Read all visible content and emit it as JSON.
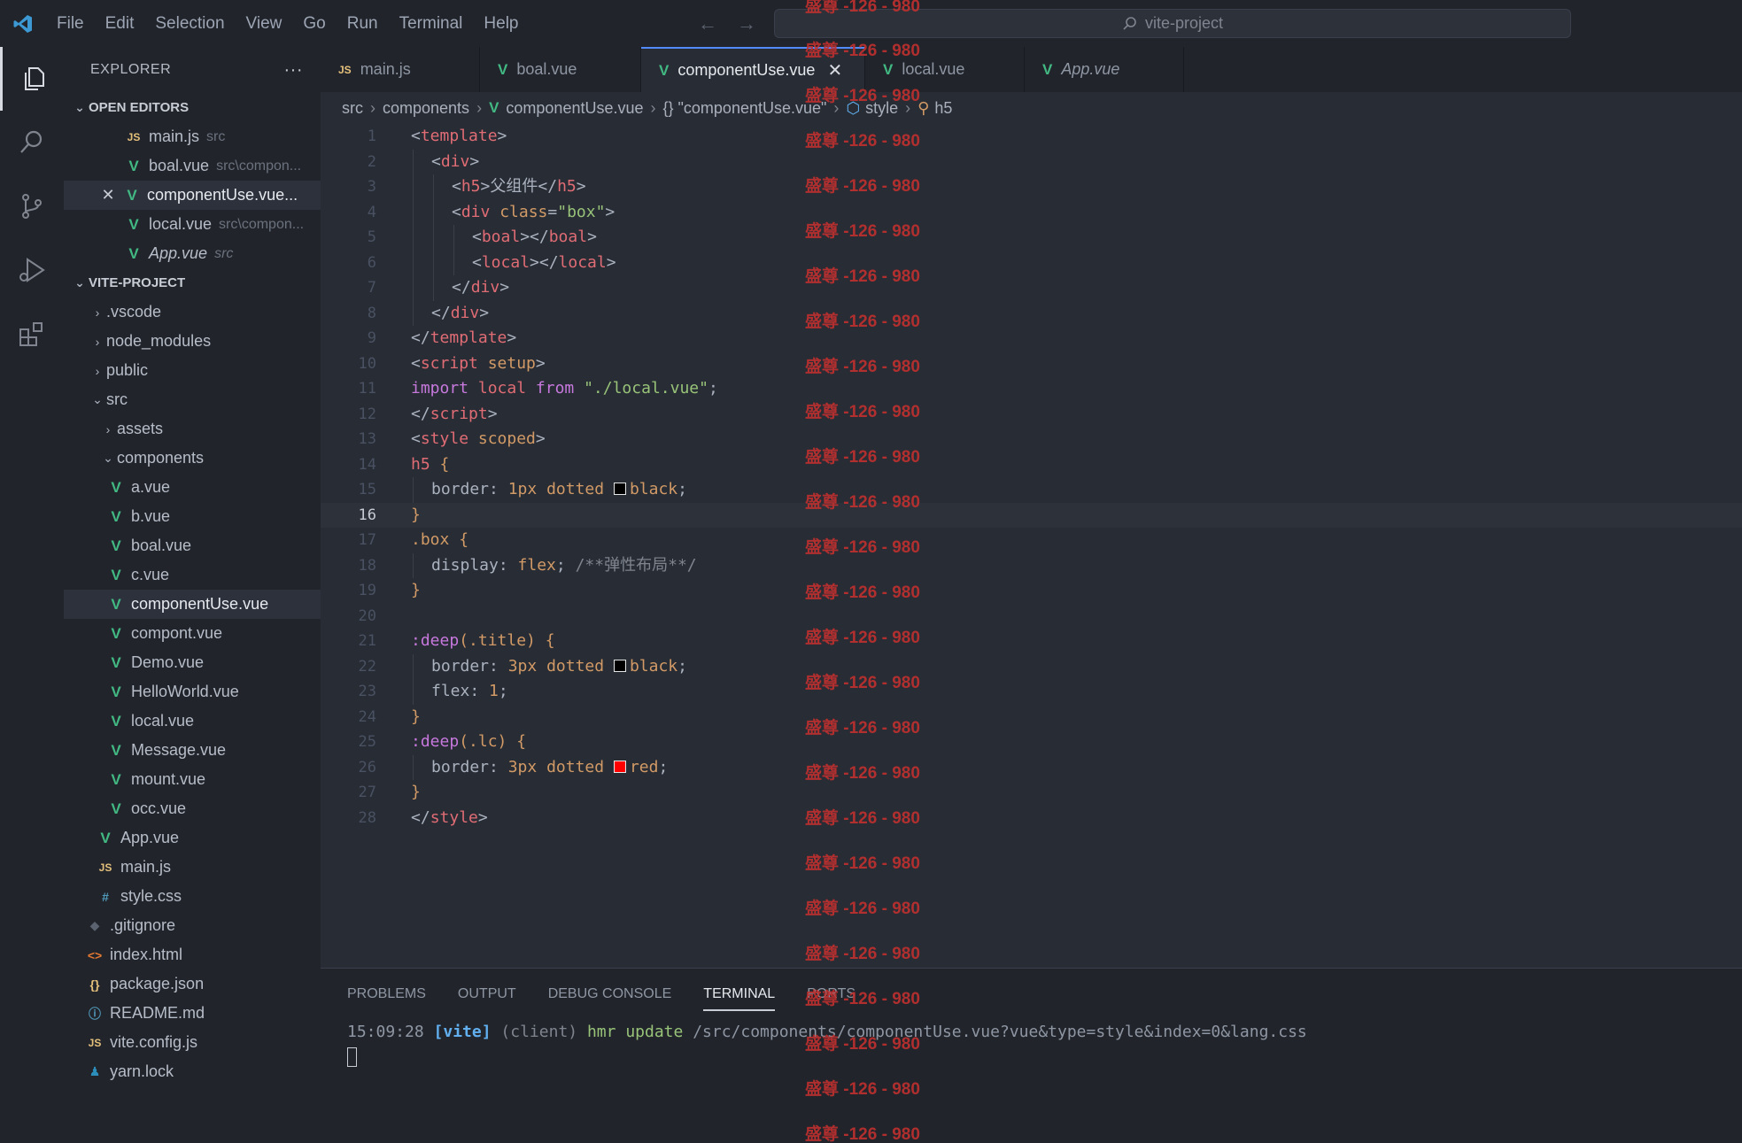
{
  "menu": [
    "File",
    "Edit",
    "Selection",
    "View",
    "Go",
    "Run",
    "Terminal",
    "Help"
  ],
  "command_center": "vite-project",
  "explorer": {
    "title": "EXPLORER",
    "more": "···",
    "open_editors_title": "OPEN EDITORS",
    "open_editors": [
      {
        "icon": "JS",
        "name": "main.js",
        "path": "src"
      },
      {
        "icon": "V",
        "name": "boal.vue",
        "path": "src\\compon..."
      },
      {
        "icon": "V",
        "name": "componentUse.vue...",
        "path": ""
      },
      {
        "icon": "V",
        "name": "local.vue",
        "path": "src\\compon..."
      },
      {
        "icon": "V",
        "name": "App.vue",
        "path": "src"
      }
    ],
    "project_title": "VITE-PROJECT",
    "tree": [
      {
        "name": ".vscode",
        "type": "folder"
      },
      {
        "name": "node_modules",
        "type": "folder"
      },
      {
        "name": "public",
        "type": "folder"
      },
      {
        "name": "src",
        "type": "folder-open"
      },
      {
        "name": "assets",
        "type": "folder"
      },
      {
        "name": "components",
        "type": "folder-open"
      },
      {
        "name": "a.vue",
        "type": "vue"
      },
      {
        "name": "b.vue",
        "type": "vue"
      },
      {
        "name": "boal.vue",
        "type": "vue"
      },
      {
        "name": "c.vue",
        "type": "vue"
      },
      {
        "name": "componentUse.vue",
        "type": "vue"
      },
      {
        "name": "compont.vue",
        "type": "vue"
      },
      {
        "name": "Demo.vue",
        "type": "vue"
      },
      {
        "name": "HelloWorld.vue",
        "type": "vue"
      },
      {
        "name": "local.vue",
        "type": "vue"
      },
      {
        "name": "Message.vue",
        "type": "vue"
      },
      {
        "name": "mount.vue",
        "type": "vue"
      },
      {
        "name": "occ.vue",
        "type": "vue"
      },
      {
        "name": "App.vue",
        "type": "vue"
      },
      {
        "name": "main.js",
        "type": "js"
      },
      {
        "name": "style.css",
        "type": "css"
      },
      {
        "name": ".gitignore",
        "type": "git"
      },
      {
        "name": "index.html",
        "type": "html"
      },
      {
        "name": "package.json",
        "type": "json"
      },
      {
        "name": "README.md",
        "type": "info"
      },
      {
        "name": "vite.config.js",
        "type": "js"
      },
      {
        "name": "yarn.lock",
        "type": "yarn"
      }
    ]
  },
  "tabs": [
    {
      "icon": "JS",
      "label": "main.js"
    },
    {
      "icon": "V",
      "label": "boal.vue"
    },
    {
      "icon": "V",
      "label": "componentUse.vue",
      "close": "✕"
    },
    {
      "icon": "V",
      "label": "local.vue"
    },
    {
      "icon": "V",
      "label": "App.vue"
    }
  ],
  "breadcrumb": {
    "src": "src",
    "components": "components",
    "file": "componentUse.vue",
    "block": "{} \"componentUse.vue\"",
    "style": "style",
    "h5": "h5"
  },
  "code": {
    "line_numbers": [
      "1",
      "2",
      "3",
      "4",
      "5",
      "6",
      "7",
      "8",
      "9",
      "10",
      "11",
      "12",
      "13",
      "14",
      "15",
      "16",
      "17",
      "18",
      "19",
      "20",
      "21",
      "22",
      "23",
      "24",
      "25",
      "26",
      "27",
      "28"
    ],
    "l1": [
      "<",
      "template",
      ">"
    ],
    "l2": [
      "<",
      "div",
      ">"
    ],
    "l3": [
      "<",
      "h5",
      ">",
      "父组件",
      "</",
      "h5",
      ">"
    ],
    "l4": [
      "<",
      "div",
      " class",
      "=",
      "\"box\"",
      ">"
    ],
    "l5": [
      "<",
      "boal",
      "></",
      "boal",
      ">"
    ],
    "l6": [
      "<",
      "local",
      "></",
      "local",
      ">"
    ],
    "l7": [
      "</",
      "div",
      ">"
    ],
    "l8": [
      "</",
      "div",
      ">"
    ],
    "l9": [
      "</",
      "template",
      ">"
    ],
    "l10": [
      "<",
      "script",
      " setup",
      ">"
    ],
    "l11": [
      "import",
      " local ",
      "from",
      " \"./local.vue\"",
      ";"
    ],
    "l12": [
      "</",
      "script",
      ">"
    ],
    "l13": [
      "<",
      "style",
      " scoped",
      ">"
    ],
    "l14": [
      "h5",
      " {"
    ],
    "l15": [
      "border",
      ": ",
      "1px",
      " dotted ",
      "black",
      ";"
    ],
    "l16": [
      "}"
    ],
    "l17": [
      ".box",
      " {"
    ],
    "l18": [
      "display",
      ": ",
      "flex",
      "; ",
      "/**弹性布局**/"
    ],
    "l19": [
      "}"
    ],
    "l20": [
      ""
    ],
    "l21": [
      ":deep",
      "(.title)",
      " {"
    ],
    "l22": [
      "border",
      ": ",
      "3px",
      " dotted ",
      "black",
      ";"
    ],
    "l23": [
      "flex",
      ": ",
      "1",
      ";"
    ],
    "l24": [
      "}"
    ],
    "l25": [
      ":deep",
      "(.lc)",
      " {"
    ],
    "l26": [
      "border",
      ": ",
      "3px",
      " dotted ",
      "red",
      ";"
    ],
    "l27": [
      "}"
    ],
    "l28": [
      "</",
      "style",
      ">"
    ]
  },
  "panel": {
    "tabs": [
      "PROBLEMS",
      "OUTPUT",
      "DEBUG CONSOLE",
      "TERMINAL",
      "PORTS"
    ],
    "active_tab": "TERMINAL",
    "terminal": {
      "time": "15:09:28",
      "tag": "[vite]",
      "client": "(client)",
      "msg": "hmr update",
      "path": "/src/components/componentUse.vue?vue&type=style&index=0&lang.css"
    }
  },
  "watermark": "盛尊 -126 - 980",
  "colors": {
    "accent": "#528bff",
    "watermark": "#c0302f",
    "vue": "#42b883",
    "swatch_black": "#000000",
    "swatch_red": "#ff0000"
  }
}
